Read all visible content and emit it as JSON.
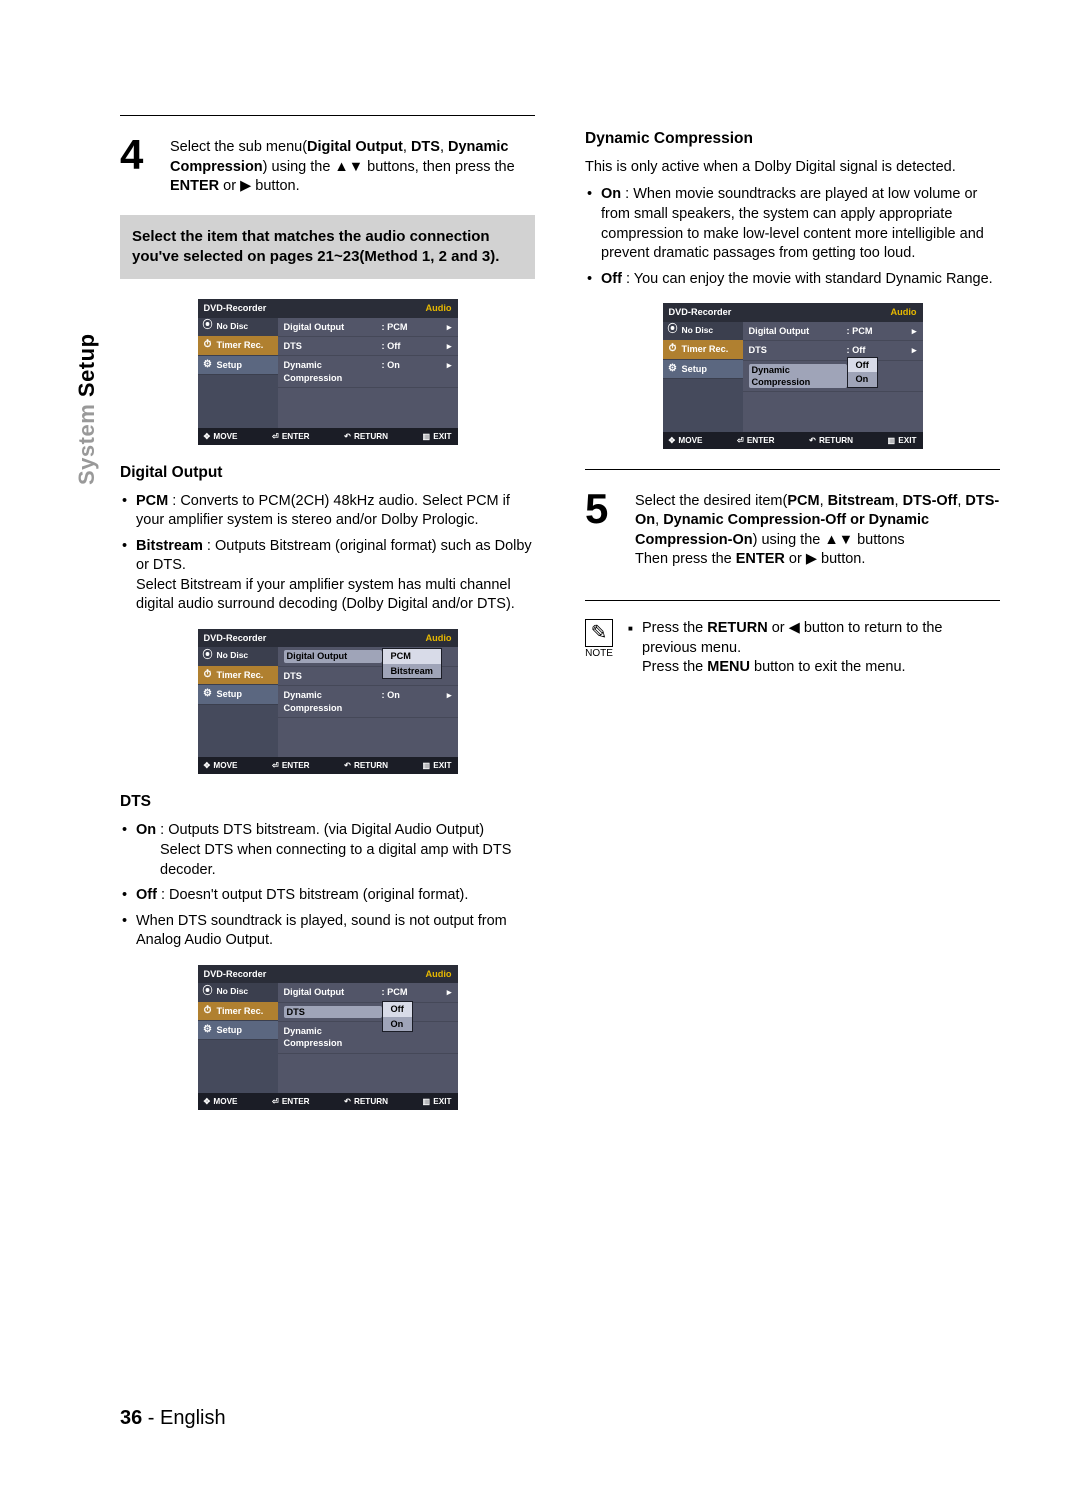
{
  "sideTab": {
    "gray": "System ",
    "black": "Setup"
  },
  "pageFooter": {
    "num": "36",
    "sep": " - ",
    "lang": "English"
  },
  "left": {
    "step4": {
      "num": "4",
      "t1": "Select the sub menu(",
      "b1": "Digital Output",
      "b2": "DTS",
      "b3": "Dynamic Compression",
      "t2": ") using the ▲▼ buttons, then press the ",
      "b4": "ENTER",
      "t3": " or ▶ button."
    },
    "greybox": "Select the item that matches the audio connection you've selected on pages 21~23(Method 1, 2 and 3).",
    "digitalOutput": {
      "title": "Digital Output",
      "pcm": {
        "b": "PCM",
        "t": " : Converts to PCM(2CH) 48kHz audio. Select PCM if your amplifier system is stereo and/or Dolby Prologic."
      },
      "bitstream": {
        "b": "Bitstream",
        "t": " : Outputs Bitstream (original format) such as Dolby or DTS.",
        "t2": "Select Bitstream if your amplifier system has multi channel digital audio surround decoding (Dolby Digital and/or DTS)."
      }
    },
    "dts": {
      "title": "DTS",
      "on": {
        "b": "On",
        "t": " : Outputs DTS bitstream. (via Digital Audio Output)",
        "t2": "Select DTS when connecting to a digital amp with DTS decoder."
      },
      "off": {
        "b": "Off",
        "t": " : Doesn't output DTS bitstream (original format)."
      },
      "extra": "When DTS soundtrack is played, sound is not output from Analog Audio Output."
    }
  },
  "right": {
    "dc": {
      "title": "Dynamic Compression",
      "intro": "This is only active when a Dolby Digital signal is detected.",
      "on": {
        "b": "On",
        "t": " : When movie soundtracks are played at low volume or from small speakers, the system can apply appropriate compression to make low-level content more intelligible and prevent dramatic passages from getting too loud."
      },
      "off": {
        "b": "Off",
        "t": " : You can enjoy the movie with standard Dynamic Range."
      }
    },
    "step5": {
      "num": "5",
      "t1": "Select the desired item(",
      "b1": "PCM",
      "b2": "Bitstream",
      "b3": "DTS-Off",
      "b4": "DTS-On",
      "b5": "Dynamic Compression-Off or Dynamic Compression-On",
      "t2": ") using the ▲▼ buttons",
      "t3": "Then press the ",
      "b6": "ENTER",
      "t4": " or ▶ button."
    },
    "note": {
      "label": "NOTE",
      "l1a": "Press the ",
      "l1b": "RETURN",
      "l1c": " or ◀ button to return to the previous menu.",
      "l2a": "Press the ",
      "l2b": "MENU",
      "l2c": " button to exit the menu."
    }
  },
  "osd": {
    "title": "DVD-Recorder",
    "titleR": "Audio",
    "nodisc": "No Disc",
    "timer": "Timer Rec.",
    "setup": "Setup",
    "r1": "Digital Output",
    "r2": "DTS",
    "r3": "Dynamic Compression",
    "vPCM": ": PCM",
    "vOff": ": Off",
    "vOn": ": On",
    "optPCM": "PCM",
    "optBitstream": "Bitstream",
    "optOff": "Off",
    "optOn": "On",
    "fMove": "MOVE",
    "fEnter": "ENTER",
    "fReturn": "RETURN",
    "fExit": "EXIT"
  }
}
